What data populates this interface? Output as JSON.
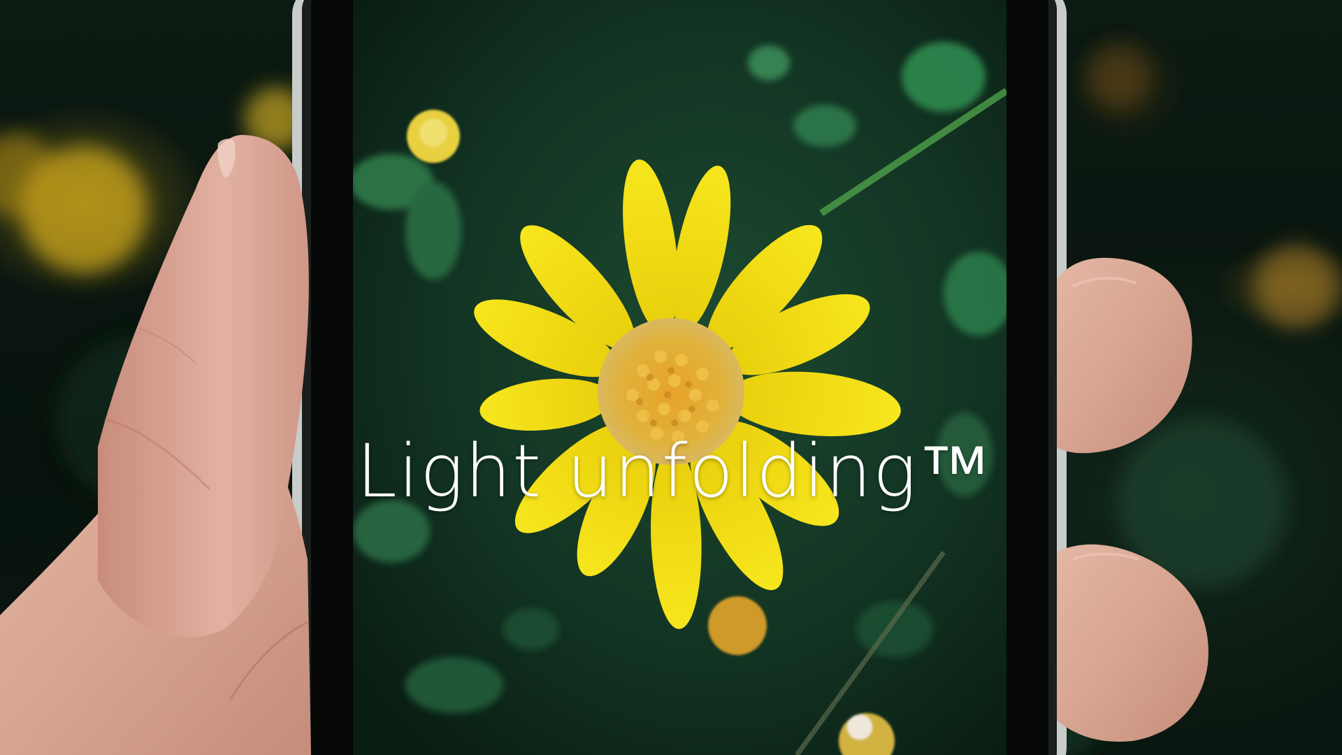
{
  "caption": {
    "title": "Light unfolding™"
  },
  "colors": {
    "petal": "#f2dc12",
    "center": "#e0a628",
    "foliage": "#1f5a36",
    "skin": "#d9a896",
    "phone_frame": "#1a1f1c"
  },
  "scene": {
    "subject": "yellow-daisy",
    "device": "smartphone",
    "hand": "left-hand-holding-phone"
  }
}
